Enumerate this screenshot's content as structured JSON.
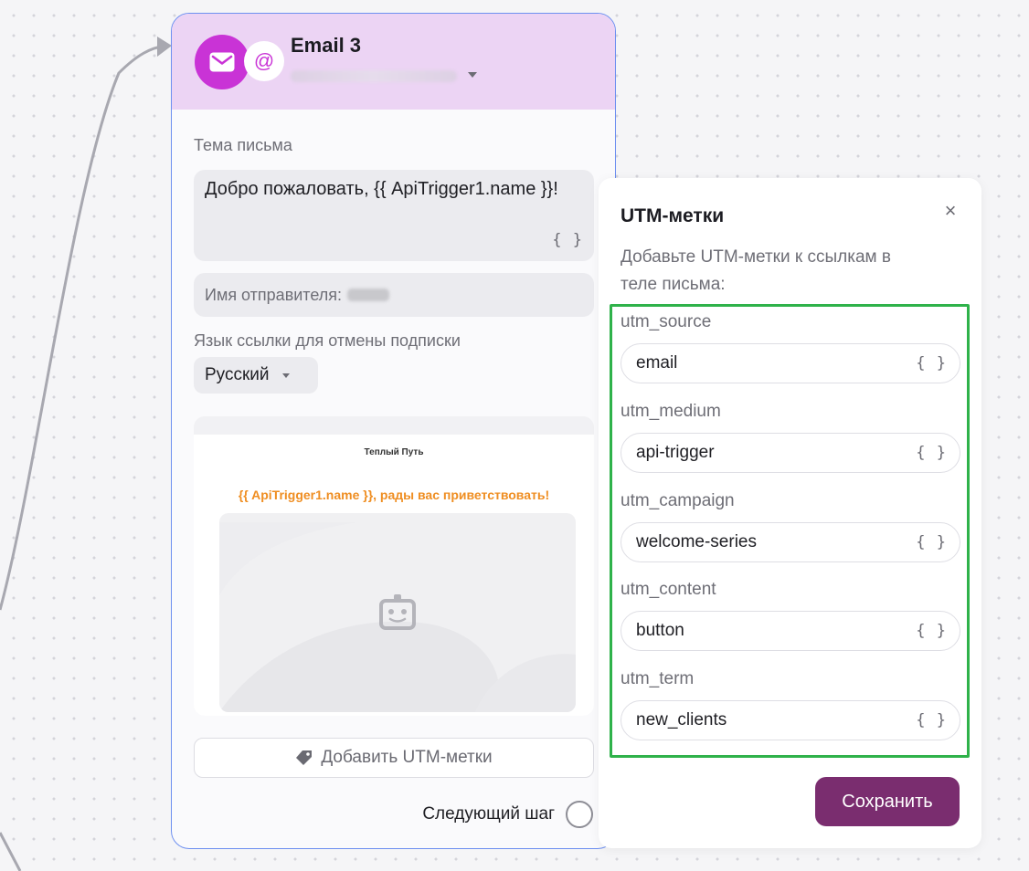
{
  "colors": {
    "accent": "#c933d6",
    "header_bg": "#ecd4f4",
    "node_border": "#6d8ff0",
    "highlight": "#2fb24a",
    "preview_greeting": "#ef8e22",
    "save_button": "#7a2d6f"
  },
  "node": {
    "title": "Email 3",
    "subject_label": "Тема письма",
    "subject_value": "Добро пожаловать, {{ ApiTrigger1.name }}!",
    "sender_label": "Имя отправителя:",
    "unsubscribe_lang_label": "Язык ссылки для отмены подписки",
    "language_value": "Русский",
    "preview": {
      "brand": "Теплый Путь",
      "greeting": "{{ ApiTrigger1.name }}, рады вас приветствовать!"
    },
    "add_utm_label": "Добавить UTM-метки",
    "next_step_label": "Следующий шаг",
    "icons": [
      "mail-icon",
      "at-icon",
      "chevron-down-icon",
      "braces-icon",
      "image-placeholder-icon",
      "tag-icon"
    ]
  },
  "utm_panel": {
    "title": "UTM-метки",
    "description": "Добавьте UTM-метки к ссылкам в теле письма:",
    "fields": [
      {
        "label": "utm_source",
        "value": "email"
      },
      {
        "label": "utm_medium",
        "value": "api-trigger"
      },
      {
        "label": "utm_campaign",
        "value": "welcome-series"
      },
      {
        "label": "utm_content",
        "value": "button"
      },
      {
        "label": "utm_term",
        "value": "new_clients"
      }
    ],
    "variable_glyph": "{ }",
    "close_glyph": "×",
    "save_label": "Сохранить"
  }
}
